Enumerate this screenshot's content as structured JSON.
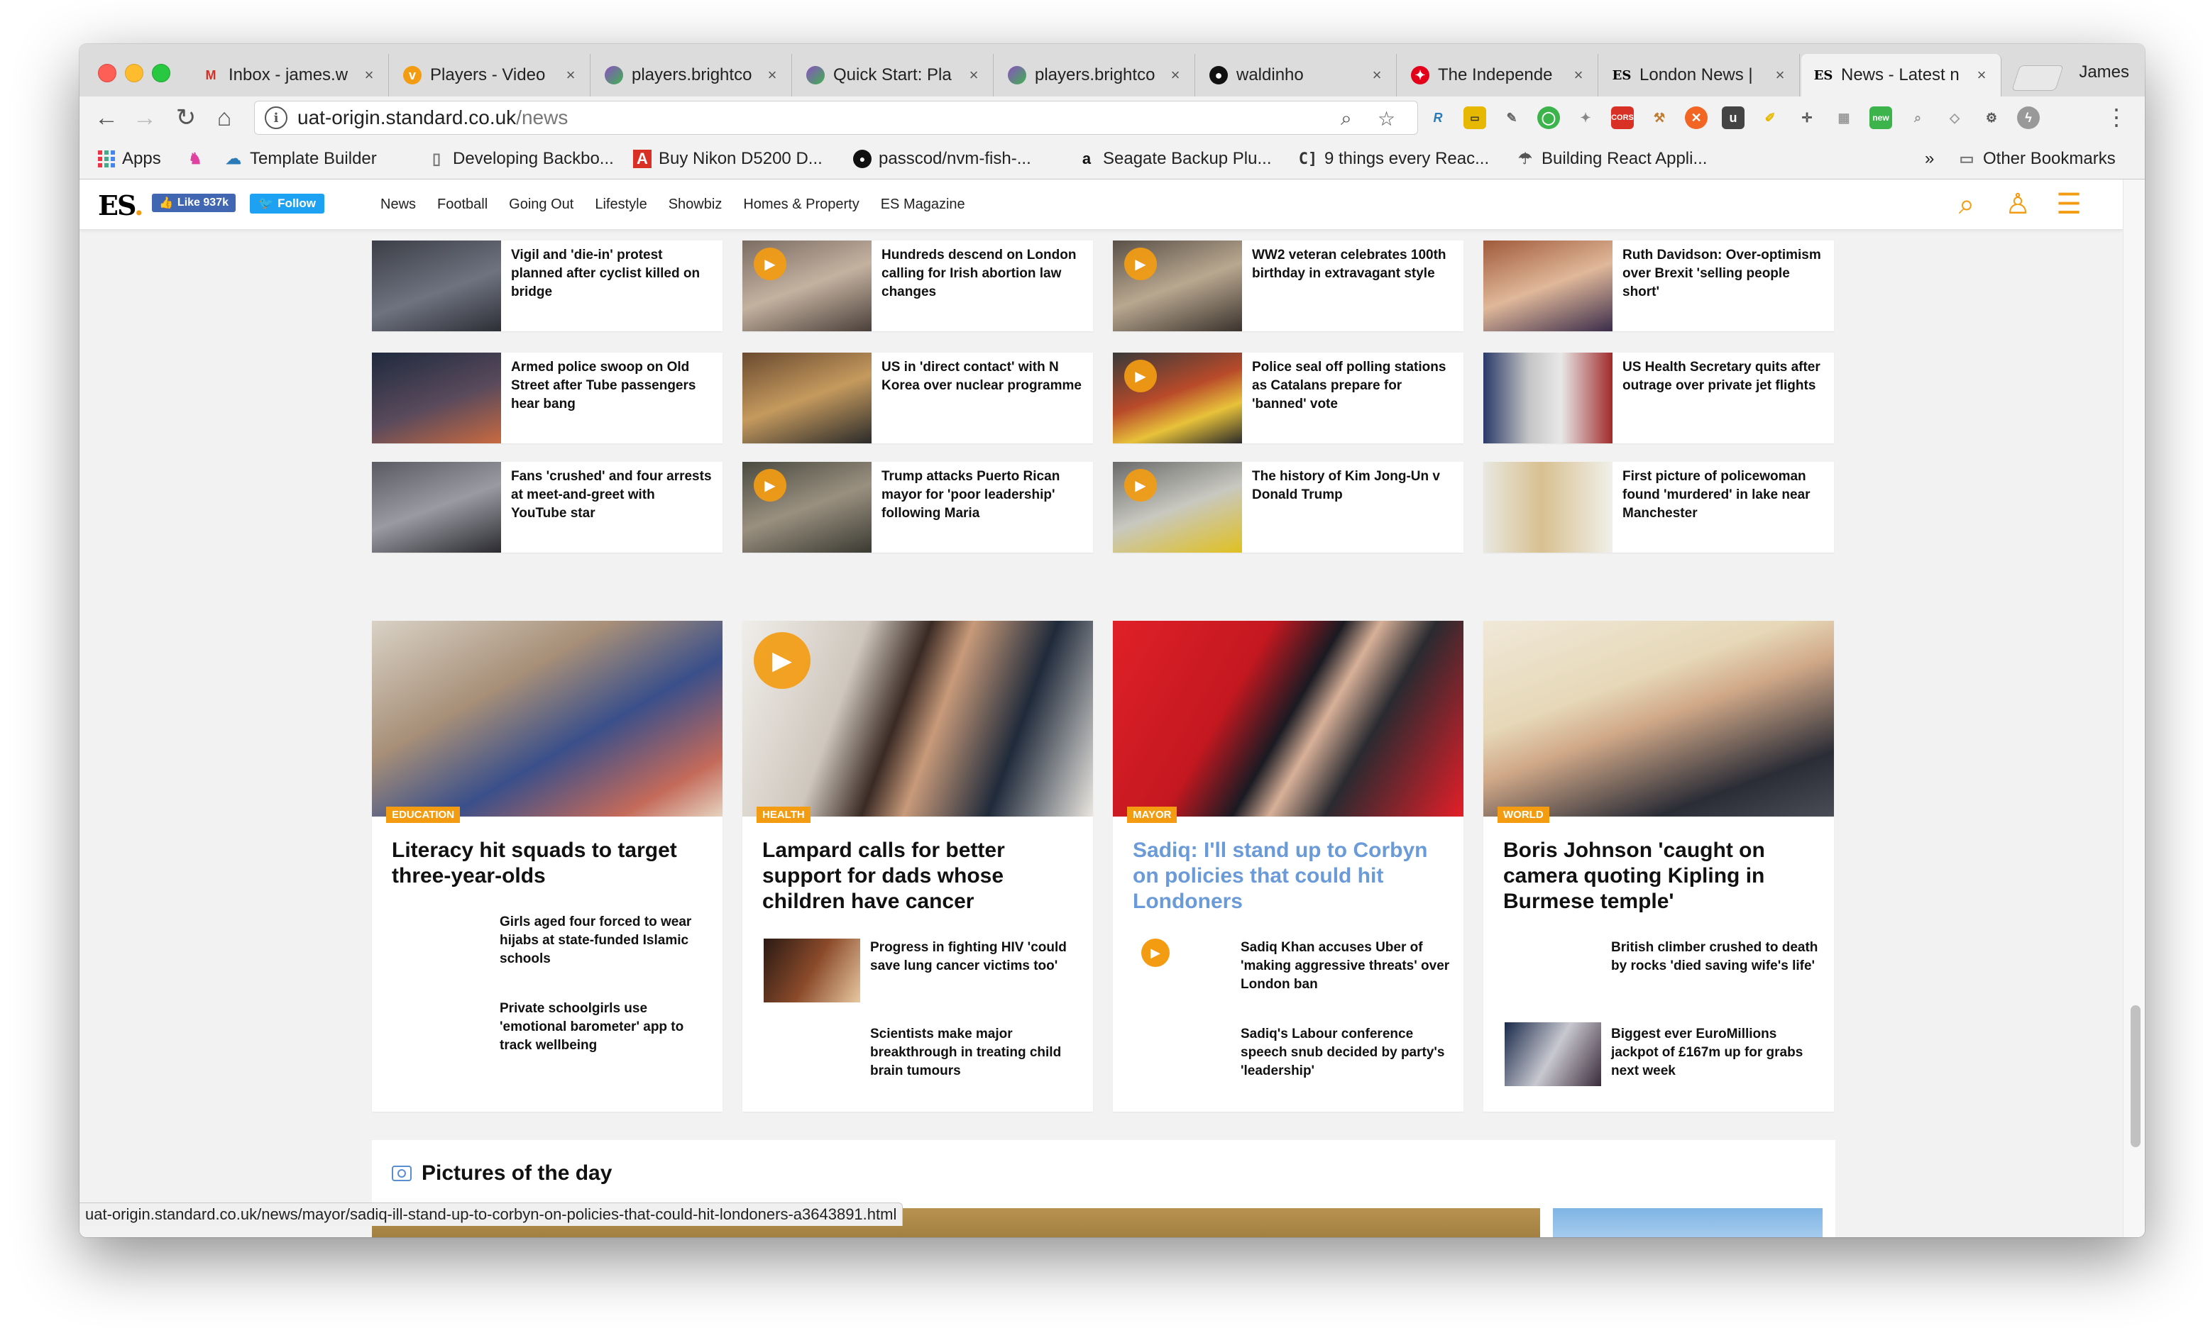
{
  "browser": {
    "tabs": [
      {
        "title": "Inbox - james.w",
        "icon": "gmail-icon"
      },
      {
        "title": "Players - Video",
        "icon": "vimeo-icon"
      },
      {
        "title": "players.brightco",
        "icon": "brightcove-icon"
      },
      {
        "title": "Quick Start: Pla",
        "icon": "brightcove-icon"
      },
      {
        "title": "players.brightco",
        "icon": "brightcove-icon"
      },
      {
        "title": "waldinho",
        "icon": "github-icon"
      },
      {
        "title": "The Independe",
        "icon": "independent-icon"
      },
      {
        "title": "London News |",
        "icon": "es-icon"
      },
      {
        "title": "News - Latest n",
        "icon": "es-icon",
        "active": true
      }
    ],
    "profile_name": "James",
    "url_host": "uat-origin.standard.co.uk",
    "url_path": "/news",
    "bookmarks": [
      {
        "label": "Apps"
      },
      {
        "label": ""
      },
      {
        "label": "Template Builder"
      },
      {
        "label": "Developing Backbo..."
      },
      {
        "label": "Buy Nikon D5200 D..."
      },
      {
        "label": "passcod/nvm-fish-..."
      },
      {
        "label": "Seagate Backup Plu..."
      },
      {
        "label": "9 things every Reac..."
      },
      {
        "label": "Building React Appli..."
      }
    ],
    "bookmarks_overflow": "»",
    "other_bookmarks": "Other Bookmarks",
    "status_url": "uat-origin.standard.co.uk/news/mayor/sadiq-ill-stand-up-to-corbyn-on-policies-that-could-hit-londoners-a3643891.html"
  },
  "site": {
    "logo": "ES",
    "fb_like": "Like 937k",
    "tw_follow": "Follow",
    "nav": [
      "News",
      "Football",
      "Going Out",
      "Lifestyle",
      "Showbiz",
      "Homes & Property",
      "ES Magazine"
    ]
  },
  "small_cards": [
    {
      "text": "Vigil and 'die-in' protest planned after cyclist killed on bridge",
      "video": false
    },
    {
      "text": "Hundreds descend on London calling for Irish abortion law changes",
      "video": true
    },
    {
      "text": "WW2 veteran celebrates 100th birthday in extravagant style",
      "video": true
    },
    {
      "text": "Ruth Davidson: Over-optimism over Brexit 'selling people short'",
      "video": false
    },
    {
      "text": "Armed police swoop on Old Street after Tube passengers hear bang",
      "video": false
    },
    {
      "text": "US in 'direct contact' with N Korea over nuclear programme",
      "video": false
    },
    {
      "text": "Police seal off polling stations as Catalans prepare for 'banned' vote",
      "video": true
    },
    {
      "text": "US Health Secretary quits after outrage over private jet flights",
      "video": false
    },
    {
      "text": "Fans 'crushed' and four arrests at meet-and-greet with YouTube star",
      "video": false
    },
    {
      "text": "Trump attacks Puerto Rican mayor for 'poor leadership' following Maria",
      "video": true
    },
    {
      "text": "The history of Kim Jong-Un v Donald Trump",
      "video": true
    },
    {
      "text": "First picture of policewoman found 'murdered' in lake near Manchester",
      "video": false
    }
  ],
  "large_cards": [
    {
      "tag": "EDUCATION",
      "headline": "Literacy hit squads to target three-year-olds",
      "subs": [
        "Girls aged four forced to wear hijabs at state-funded Islamic schools",
        "Private schoolgirls use 'emotional barometer' app to track wellbeing"
      ]
    },
    {
      "tag": "HEALTH",
      "headline": "Lampard calls for better support for dads whose children have cancer",
      "subs": [
        "Progress in fighting HIV 'could save lung cancer victims too'",
        "Scientists make major breakthrough in treating child brain tumours"
      ]
    },
    {
      "tag": "MAYOR",
      "headline": "Sadiq: I'll stand up to Corbyn on policies that could hit Londoners",
      "subs": [
        "Sadiq Khan accuses Uber of 'making aggressive threats' over London ban",
        "Sadiq's Labour conference speech snub decided by party's 'leadership'"
      ]
    },
    {
      "tag": "WORLD",
      "headline": "Boris Johnson 'caught on camera quoting Kipling in Burmese temple'",
      "subs": [
        "British climber crushed to death by rocks 'died saving wife's life'",
        "Biggest ever EuroMillions jackpot of £167m up for grabs next week"
      ]
    }
  ],
  "pictures_of_the_day": {
    "title": "Pictures of the day"
  },
  "colors": {
    "accent": "#f39c12",
    "link_hover": "#6a9bd8"
  }
}
